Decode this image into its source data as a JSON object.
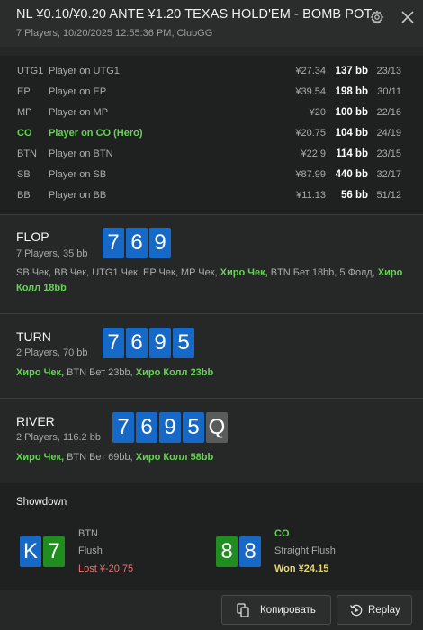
{
  "header": {
    "title": "NL ¥0.10/¥0.20 ANTE ¥1.20 TEXAS HOLD'EM - BOMB POT",
    "subtitle": "7 Players, 10/20/2025 12:55:36 PM, ClubGG"
  },
  "players": [
    {
      "pos": "UTG1",
      "name": "Player on UTG1",
      "money": "¥27.34",
      "bb": "137 bb",
      "stat": "23/13",
      "hero": false
    },
    {
      "pos": "EP",
      "name": "Player on EP",
      "money": "¥39.54",
      "bb": "198 bb",
      "stat": "30/11",
      "hero": false
    },
    {
      "pos": "MP",
      "name": "Player on MP",
      "money": "¥20",
      "bb": "100 bb",
      "stat": "22/16",
      "hero": false
    },
    {
      "pos": "CO",
      "name": "Player on CO (Hero)",
      "money": "¥20.75",
      "bb": "104 bb",
      "stat": "24/19",
      "hero": true
    },
    {
      "pos": "BTN",
      "name": "Player on BTN",
      "money": "¥22.9",
      "bb": "114 bb",
      "stat": "23/15",
      "hero": false
    },
    {
      "pos": "SB",
      "name": "Player on SB",
      "money": "¥87.99",
      "bb": "440 bb",
      "stat": "32/17",
      "hero": false
    },
    {
      "pos": "BB",
      "name": "Player on BB",
      "money": "¥11.13",
      "bb": "56 bb",
      "stat": "51/12",
      "hero": false
    }
  ],
  "streets": {
    "flop": {
      "name": "FLOP",
      "info": "7 Players, 35 bb",
      "cards": [
        "7",
        "6",
        "9"
      ],
      "actions": [
        {
          "t": "SB Чек, ",
          "h": false
        },
        {
          "t": "BB Чек, ",
          "h": false
        },
        {
          "t": "UTG1 Чек, ",
          "h": false
        },
        {
          "t": "EP Чек, ",
          "h": false
        },
        {
          "t": "MP Чек, ",
          "h": false
        },
        {
          "t": "Хиро Чек, ",
          "h": true
        },
        {
          "t": "BTN Бет 18bb, ",
          "h": false
        },
        {
          "t": "5 Фолд, ",
          "h": false
        },
        {
          "t": "Хиро Колл 18bb",
          "h": true
        }
      ]
    },
    "turn": {
      "name": "TURN",
      "info": "2 Players, 70 bb",
      "cards": [
        "7",
        "6",
        "9",
        "5"
      ],
      "actions": [
        {
          "t": "Хиро Чек, ",
          "h": true
        },
        {
          "t": "BTN Бет 23bb, ",
          "h": false
        },
        {
          "t": "Хиро Колл 23bb",
          "h": true
        }
      ]
    },
    "river": {
      "name": "RIVER",
      "info": "2 Players, 116.2 bb",
      "cards": [
        "7",
        "6",
        "9",
        "5",
        "Q"
      ],
      "actions": [
        {
          "t": "Хиро Чек, ",
          "h": true
        },
        {
          "t": "BTN Бет 69bb, ",
          "h": false
        },
        {
          "t": "Хиро Колл 58bb",
          "h": true
        }
      ]
    }
  },
  "showdown": {
    "title": "Showdown",
    "left": {
      "cards": [
        "K",
        "7"
      ],
      "pos": "BTN",
      "hand": "Flush",
      "result": "Lost ¥-20.75"
    },
    "right": {
      "cards": [
        "8",
        "8"
      ],
      "pos": "CO",
      "hand": "Straight Flush",
      "result": "Won ¥24.15"
    }
  },
  "buttons": {
    "copy": "Копировать",
    "replay": "Replay"
  },
  "icons": {
    "settings": "gear-icon",
    "close": "close-icon",
    "copy": "copy-icon",
    "replay": "replay-icon"
  },
  "colors": {
    "card_blue": "#1769c8",
    "card_green": "#1f8e1f",
    "card_gray": "#595c5b",
    "hero_green": "#67d356",
    "lost_red": "#f07070",
    "won_yellow": "#e6d670"
  }
}
